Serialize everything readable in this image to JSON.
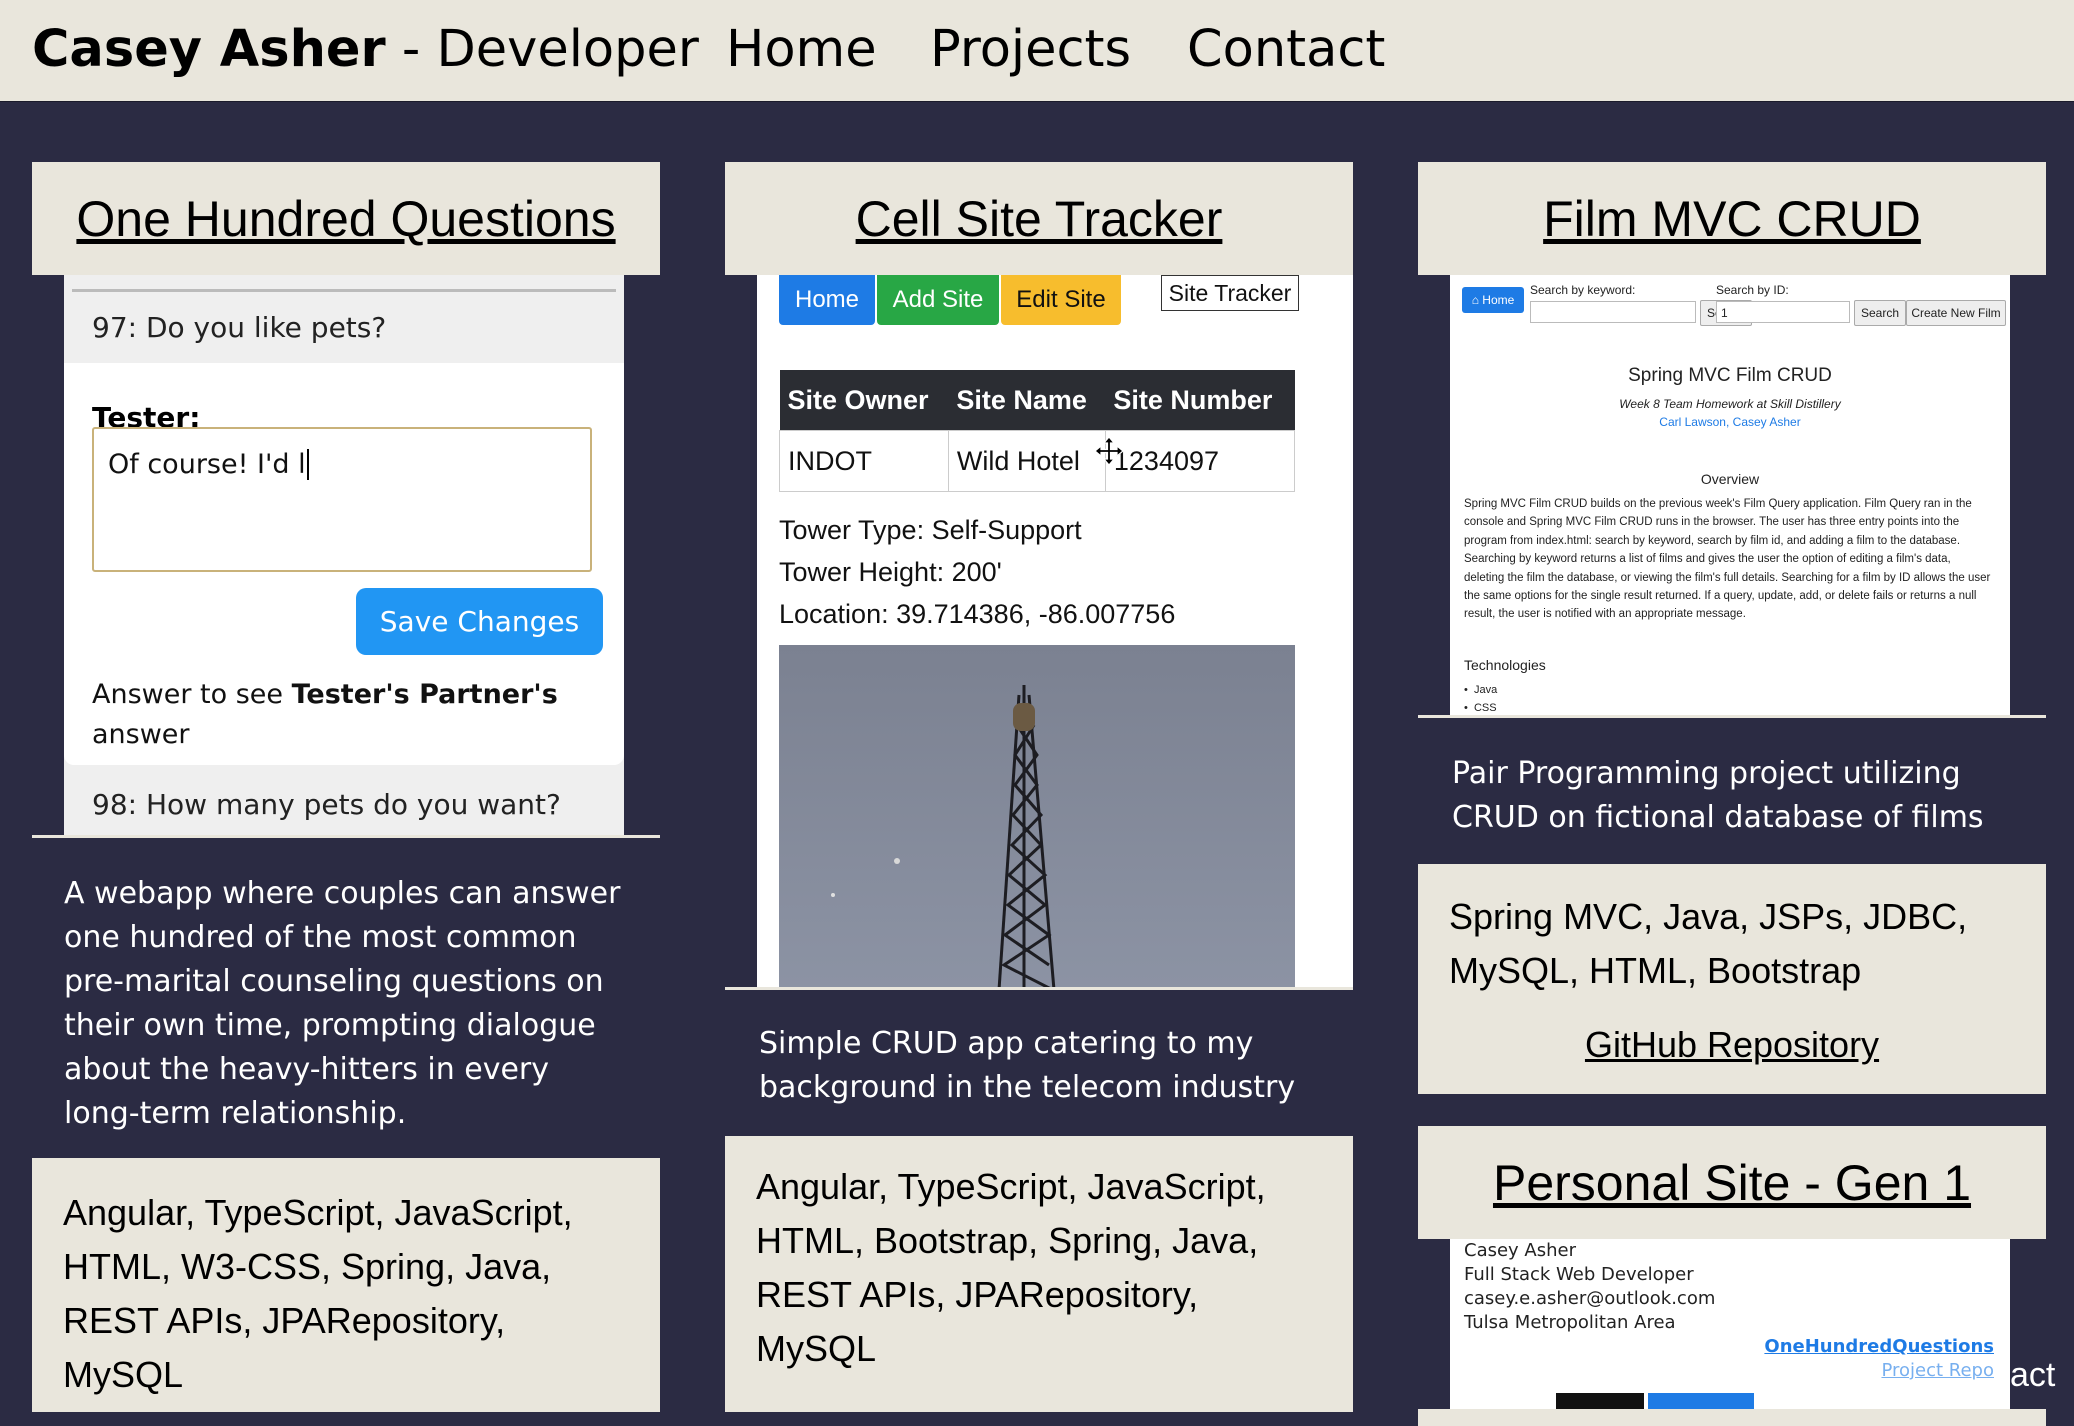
{
  "header": {
    "brand_name": "Casey Asher",
    "brand_suffix": " - Developer",
    "nav": [
      "Home",
      "Projects",
      "Contact"
    ]
  },
  "projects": [
    {
      "title": "One Hundred Questions",
      "screenshot": {
        "q1": "97: Do you like pets?",
        "tester_label": "Tester:",
        "answer_value": "Of course! I'd l",
        "save_label": "Save Changes",
        "prompt_prefix": "Answer to see ",
        "prompt_bold": "Tester's Partner's",
        "prompt_suffix": " answer",
        "q2": "98: How many pets do you want?"
      },
      "description": [
        "A webapp where couples can answer",
        "one hundred of the most common",
        "pre-marital counseling questions on",
        "their own time, prompting dialogue",
        "about the heavy-hitters in every",
        "long-term relationship."
      ],
      "tech": [
        "Angular, TypeScript, JavaScript,",
        "HTML, W3-CSS, Spring, Java,",
        "REST APIs, JPARepository,",
        "MySQL"
      ]
    },
    {
      "title": "Cell Site Tracker",
      "screenshot": {
        "buttons": [
          "Home",
          "Add Site",
          "Edit Site"
        ],
        "brand": "Site Tracker",
        "headers": [
          "Site Owner",
          "Site Name",
          "Site Number"
        ],
        "row": [
          "INDOT",
          "Wild Hotel",
          "1234097"
        ],
        "tower_type": "Tower Type: Self-Support",
        "tower_height": "Tower Height: 200'",
        "location": "Location: 39.714386, -86.007756"
      },
      "description": [
        "Simple CRUD app catering to my",
        "background in the telecom industry"
      ],
      "tech": [
        "Angular, TypeScript, JavaScript,",
        "HTML, Bootstrap, Spring, Java,",
        "REST APIs, JPARepository,",
        "MySQL"
      ]
    },
    {
      "title": "Film MVC CRUD",
      "screenshot": {
        "home_btn": "Home",
        "search_kw_label": "Search by keyword:",
        "search_btn": "Search",
        "search_id_label": "Search by ID:",
        "search_id_value": "1",
        "create_btn": "Create New Film",
        "heading": "Spring MVC Film CRUD",
        "subheading": "Week 8 Team Homework at Skill Distillery",
        "author1": "Carl Lawson",
        "author_sep": ", ",
        "author2": "Casey Asher",
        "overview_title": "Overview",
        "overview_text": "Spring MVC Film CRUD builds on the previous week's Film Query application. Film Query ran in the console and Spring MVC Film CRUD runs in the browser. The user has three entry points into the program from index.html: search by keyword, search by film id, and adding a film to the database. Searching by keyword returns a list of films and gives the user the option of editing a film's data, deleting the film the database, or viewing the film's full details. Searching for a film by ID allows the user the same options for the single result returned. If a query, update, add, or delete fails or returns a null result, the user is notified with an appropriate message.",
        "tech_title": "Technologies",
        "tech_items": [
          "Java",
          "CSS"
        ]
      },
      "description": [
        "Pair Programming project utilizing",
        "CRUD on fictional database of films"
      ],
      "tech": [
        "Spring MVC, Java, JSPs, JDBC,",
        "MySQL, HTML, Bootstrap"
      ],
      "link": "GitHub Repository"
    },
    {
      "title": "Personal Site - Gen 1",
      "screenshot": {
        "lines": [
          "Casey Asher",
          "Full Stack Web Developer",
          "casey.e.asher@outlook.com",
          "Tulsa Metropolitan Area"
        ],
        "link1": "OneHundredQuestions",
        "link2": "Project Repo"
      }
    }
  ],
  "overlay_text": "act",
  "colors": {
    "page_bg": "#2b2b43",
    "card_bg": "#e9e6dc",
    "primary": "#2196f3",
    "success": "#28a745",
    "warning": "#ffc107",
    "dark": "#2b2d33"
  }
}
